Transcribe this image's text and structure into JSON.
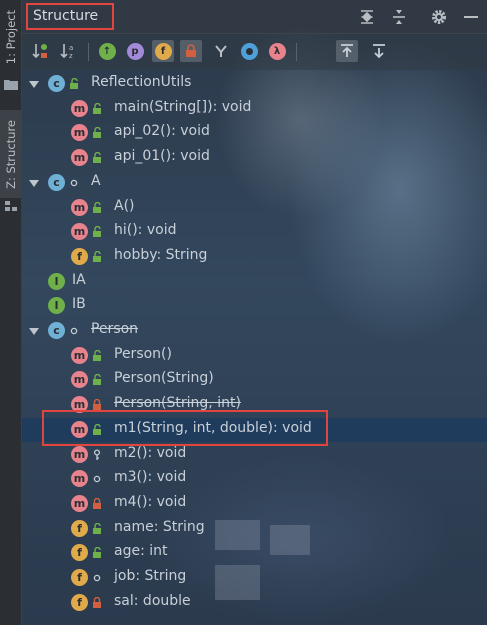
{
  "left_strip": {
    "project_tab": "1: Project",
    "structure_tab": "Z: Structure"
  },
  "header": {
    "title": "Structure"
  },
  "colors": {
    "method": "#e8828c",
    "class": "#6fb0d6",
    "field": "#e0a94a",
    "interface": "#6fb04a",
    "highlight_border": "#e0453f",
    "selected_row": "#1f3c5c"
  },
  "toolbar": {
    "icons": [
      "sort-by-visibility-icon",
      "sort-alphabetically-icon",
      "show-inherited-icon",
      "show-properties-icon",
      "show-fields-icon",
      "show-non-public-icon",
      "show-anonymous-icon",
      "show-lambdas-icon",
      "show-lambda-icon",
      "autoscroll-to-source-icon",
      "autoscroll-from-source-icon"
    ]
  },
  "tree": {
    "nodes": [
      {
        "label": "ReflectionUtils",
        "kind": "class",
        "letter": "c",
        "level": 0,
        "expanded": true
      },
      {
        "label": "main(String[]): void",
        "kind": "method",
        "letter": "m",
        "level": 1
      },
      {
        "label": "api_02(): void",
        "kind": "method",
        "letter": "m",
        "level": 1
      },
      {
        "label": "api_01(): void",
        "kind": "method",
        "letter": "m",
        "level": 1
      },
      {
        "label": "A",
        "kind": "class",
        "letter": "c",
        "level": 0,
        "expanded": true
      },
      {
        "label": "A()",
        "kind": "method",
        "letter": "m",
        "level": 1
      },
      {
        "label": "hi(): void",
        "kind": "method",
        "letter": "m",
        "level": 1
      },
      {
        "label": "hobby: String",
        "kind": "field",
        "letter": "f",
        "level": 1
      },
      {
        "label": "IA",
        "kind": "interface",
        "letter": "I",
        "level": 0
      },
      {
        "label": "IB",
        "kind": "interface",
        "letter": "I",
        "level": 0
      },
      {
        "label": "Person",
        "kind": "class",
        "letter": "c",
        "level": 0,
        "expanded": true
      },
      {
        "label": "Person()",
        "kind": "method",
        "letter": "m",
        "level": 1
      },
      {
        "label": "Person(String)",
        "kind": "method",
        "letter": "m",
        "level": 1
      },
      {
        "label": "Person(String, int)",
        "kind": "method",
        "letter": "m",
        "level": 1
      },
      {
        "label": "m1(String, int, double): void",
        "kind": "method",
        "letter": "m",
        "level": 1,
        "selected": true
      },
      {
        "label": "m2(): void",
        "kind": "method",
        "letter": "m",
        "level": 1
      },
      {
        "label": "m3(): void",
        "kind": "method",
        "letter": "m",
        "level": 1
      },
      {
        "label": "m4(): void",
        "kind": "method",
        "letter": "m",
        "level": 1
      },
      {
        "label": "name: String",
        "kind": "field",
        "letter": "f",
        "level": 1
      },
      {
        "label": "age: int",
        "kind": "field",
        "letter": "f",
        "level": 1
      },
      {
        "label": "job: String",
        "kind": "field",
        "letter": "f",
        "level": 1
      },
      {
        "label": "sal: double",
        "kind": "field",
        "letter": "f",
        "level": 1
      }
    ]
  }
}
